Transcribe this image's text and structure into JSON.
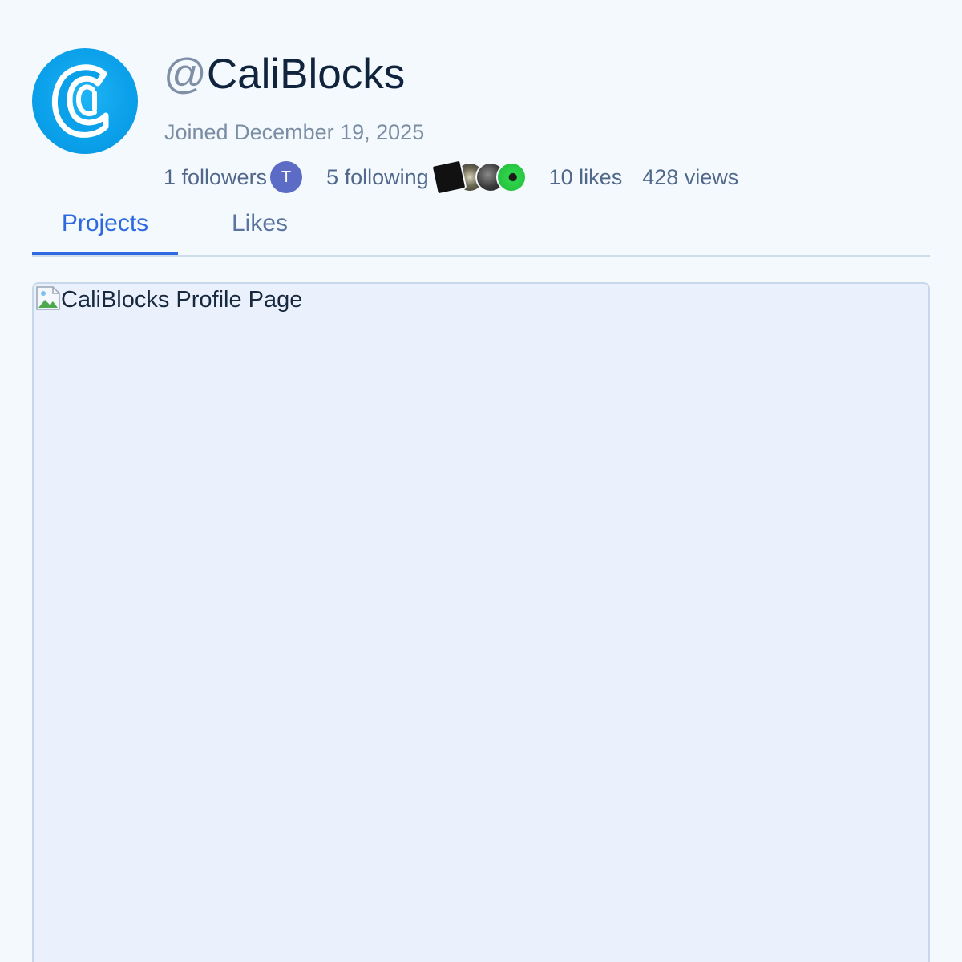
{
  "profile": {
    "handle_at": "@",
    "handle_name": "CaliBlocks",
    "joined": "Joined December 19, 2025",
    "avatar_icon": "calico-c-logo-icon",
    "avatar_color": "#0aa0ea"
  },
  "stats": {
    "followers": "1 followers",
    "follower_avatar_initial": "T",
    "following": "5 following",
    "likes": "10 likes",
    "views": "428 views"
  },
  "tabs": [
    {
      "label": "Projects",
      "active": true
    },
    {
      "label": "Likes",
      "active": false
    }
  ],
  "content": {
    "image_alt": "CaliBlocks Profile Page",
    "image_icon": "broken-image-icon"
  },
  "colors": {
    "accent": "#2d6ae0",
    "background": "#f4f9fe",
    "frame_background": "#eaf1fc"
  }
}
